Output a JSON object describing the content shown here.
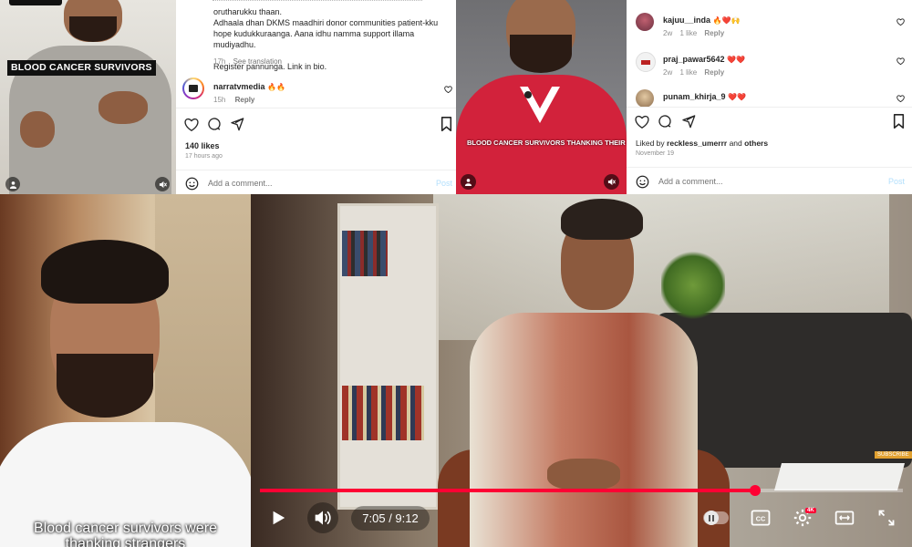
{
  "left_post": {
    "video_caption": "BLOOD CANCER SURVIVORS",
    "caption_lines": [
      "orutharukku thaan.",
      "Adhaala dhan DKMS maadhiri donor communities patient-kku",
      "hope kudukkuraanga. Aana idhu namma support illama mudiyadhu.",
      "",
      "Register pannunga. Link in bio."
    ],
    "caption_time": "17h",
    "see_translation": "See translation",
    "comment_user": "narratvmedia",
    "comment_emojis": "🔥🔥",
    "comment_time": "15h",
    "comment_reply": "Reply",
    "likes": "140 likes",
    "posted": "17 hours ago",
    "add_comment_placeholder": "Add a comment...",
    "post_label": "Post"
  },
  "right_post": {
    "video_caption": "BLOOD CANCER SURVIVORS THANKING THEIR DONORS",
    "comments": [
      {
        "user": "kajuu__inda",
        "emojis": "🔥❤️🙌",
        "time": "2w",
        "likes": "1 like",
        "reply": "Reply"
      },
      {
        "user": "praj_pawar5642",
        "emojis": "❤️❤️",
        "time": "2w",
        "likes": "1 like",
        "reply": "Reply"
      },
      {
        "user": "punam_khirja_9",
        "emojis": "❤️❤️",
        "time": "",
        "likes": "",
        "reply": ""
      }
    ],
    "liked_by_prefix": "Liked by ",
    "liked_by_user": "reckless_umerrr",
    "liked_by_and": " and ",
    "liked_by_others": "others",
    "date": "November 19",
    "add_comment_placeholder": "Add a comment...",
    "post_label": "Post"
  },
  "bottom_left_video": {
    "subtitle_line1": "Blood cancer survivors were",
    "subtitle_line2": "thanking strangers"
  },
  "youtube_player": {
    "current_time": "7:05",
    "separator": " / ",
    "duration": "9:12",
    "progress": 0.77,
    "subscribe_label": "SUBSCRIBE",
    "settings_badge": "4K",
    "accent_color": "#ff0033"
  }
}
